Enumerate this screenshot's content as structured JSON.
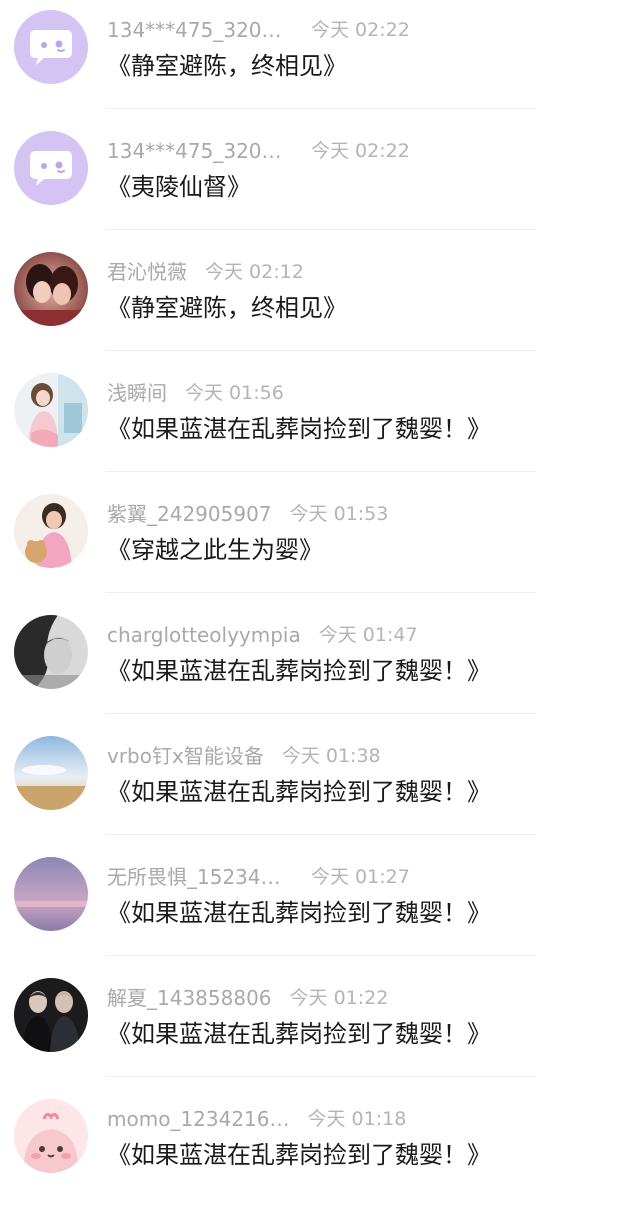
{
  "items": [
    {
      "user": "134***475_3202…",
      "time": "今天 02:22",
      "title": "《静室避陈，终相见》",
      "avatar": "default-chat-avatar"
    },
    {
      "user": "134***475_3202…",
      "time": "今天 02:22",
      "title": "《夷陵仙督》",
      "avatar": "default-chat-avatar"
    },
    {
      "user": "君沁悦薇",
      "time": "今天 02:12",
      "title": "《静室避陈，终相见》",
      "avatar": "user-avatar"
    },
    {
      "user": "浅瞬间",
      "time": "今天 01:56",
      "title": "《如果蓝湛在乱葬岗捡到了魏婴！》",
      "avatar": "user-avatar"
    },
    {
      "user": "紫翼_242905907",
      "time": "今天 01:53",
      "title": "《穿越之此生为婴》",
      "avatar": "user-avatar"
    },
    {
      "user": "charglotteolyympia",
      "time": "今天 01:47",
      "title": "《如果蓝湛在乱葬岗捡到了魏婴！》",
      "avatar": "user-avatar"
    },
    {
      "user": "vrbo钉x智能设备",
      "time": "今天 01:38",
      "title": "《如果蓝湛在乱葬岗捡到了魏婴！》",
      "avatar": "user-avatar"
    },
    {
      "user": "无所畏惧_152344…",
      "time": "今天 01:27",
      "title": "《如果蓝湛在乱葬岗捡到了魏婴！》",
      "avatar": "user-avatar"
    },
    {
      "user": "解夏_143858806",
      "time": "今天 01:22",
      "title": "《如果蓝湛在乱葬岗捡到了魏婴！》",
      "avatar": "user-avatar"
    },
    {
      "user": "momo_1234216…",
      "time": "今天 01:18",
      "title": "《如果蓝湛在乱葬岗捡到了魏婴！》",
      "avatar": "user-avatar"
    }
  ],
  "colors": {
    "default_avatar_bg": "#d3c4f3",
    "username": "#a9a9a9",
    "time": "#b4b4b4",
    "title": "#1a1a1a",
    "divider": "#f0f0f0"
  }
}
